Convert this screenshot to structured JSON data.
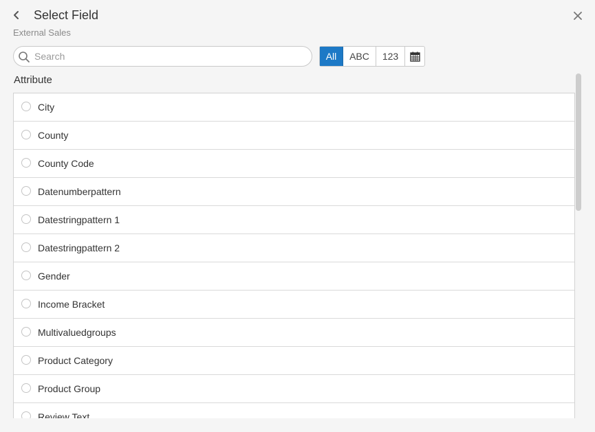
{
  "header": {
    "title": "Select Field",
    "subtitle": "External Sales"
  },
  "search": {
    "placeholder": "Search",
    "value": ""
  },
  "filters": {
    "all": "All",
    "text": "ABC",
    "number": "123",
    "date_icon": "calendar-icon",
    "selected": "All"
  },
  "section": {
    "label": "Attribute"
  },
  "fields": [
    "City",
    "County",
    "County Code",
    "Datenumberpattern",
    "Datestringpattern 1",
    "Datestringpattern 2",
    "Gender",
    "Income Bracket",
    "Multivaluedgroups",
    "Product Category",
    "Product Group",
    "Review Text"
  ],
  "colors": {
    "accent": "#1d79c6",
    "background": "#f5f5f5"
  }
}
